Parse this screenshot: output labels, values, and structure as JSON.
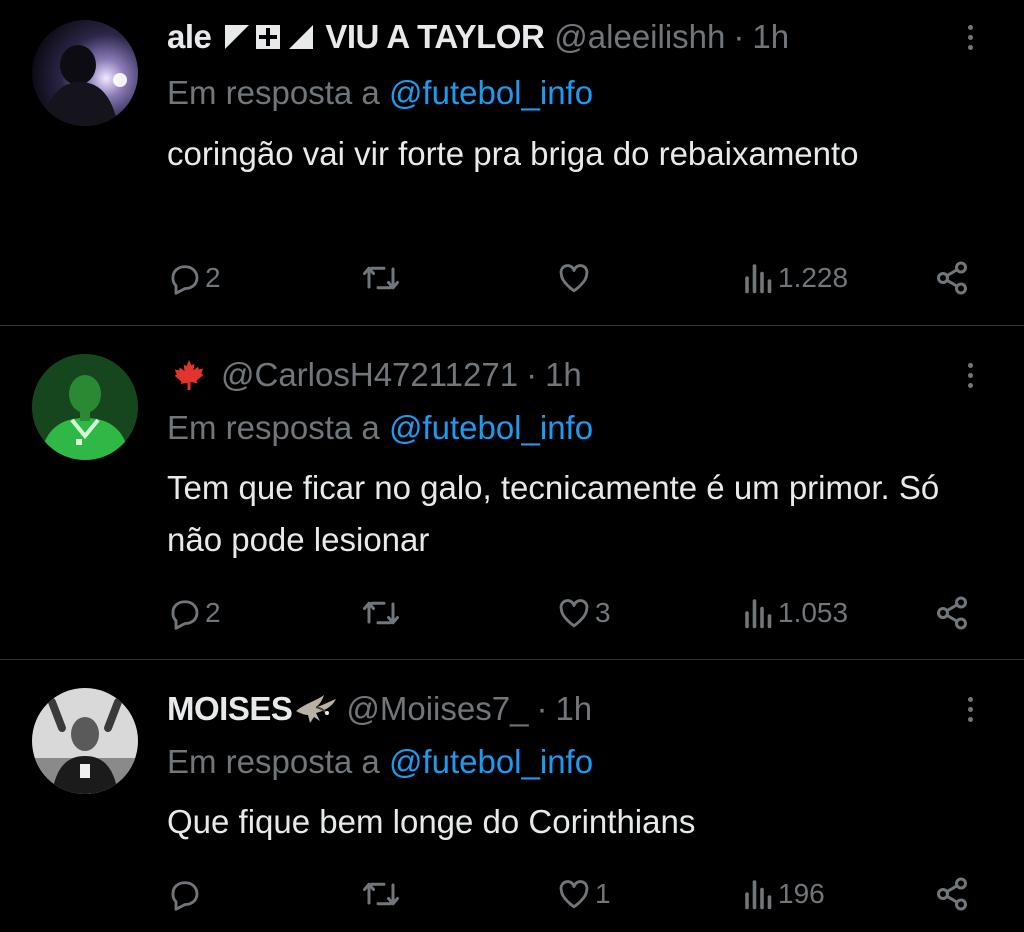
{
  "tweets": [
    {
      "name": "ale",
      "name_suffix": "VIU A TAYLOR",
      "handle": "@aleeilishh",
      "dot": "·",
      "time": "1h",
      "reply_prefix": "Em resposta a",
      "reply_to": "@futebol_info",
      "text": "coringão vai vir forte pra briga do rebaixamento",
      "replies": "2",
      "retweets": "",
      "likes": "",
      "views": "1.228"
    },
    {
      "name": "",
      "name_icon": "maple-leaf-icon",
      "handle": "@CarlosH47211271",
      "dot": "·",
      "time": "1h",
      "reply_prefix": "Em resposta a",
      "reply_to": "@futebol_info",
      "text": "Tem que ficar no galo, tecnicamente é um primor. Só não pode lesionar",
      "replies": "2",
      "retweets": "",
      "likes": "3",
      "views": "1.053"
    },
    {
      "name": "MOISES",
      "name_icon": "eagle-icon",
      "handle": "@Moiises7_",
      "dot": "·",
      "time": "1h",
      "reply_prefix": "Em resposta a",
      "reply_to": "@futebol_info",
      "text": "Que fique bem longe do Corinthians",
      "replies": "",
      "retweets": "",
      "likes": "1",
      "views": "196"
    }
  ],
  "colors": {
    "background": "#000000",
    "text": "#e7e9ea",
    "muted": "#71767b",
    "link": "#1d9bf0",
    "separator": "#2f3336"
  }
}
